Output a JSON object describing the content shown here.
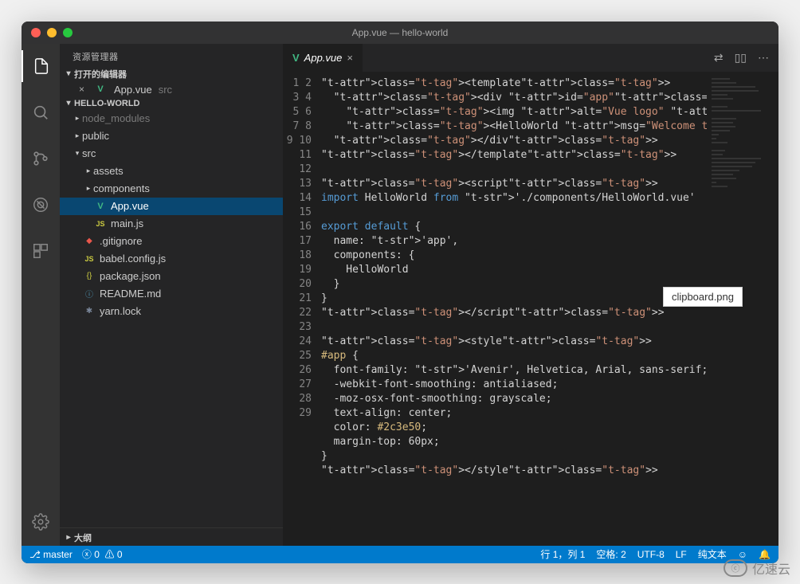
{
  "titlebar": {
    "title": "App.vue — hello-world"
  },
  "sidebar": {
    "title": "资源管理器",
    "open_editors_label": "打开的编辑器",
    "open_editor_file": "App.vue",
    "open_editor_path": "src",
    "project_label": "HELLO-WORLD",
    "outline_label": "大纲",
    "tree": {
      "node_modules": "node_modules",
      "public": "public",
      "src": "src",
      "assets": "assets",
      "components": "components",
      "app_vue": "App.vue",
      "main_js": "main.js",
      "gitignore": ".gitignore",
      "babel": "babel.config.js",
      "package": "package.json",
      "readme": "README.md",
      "yarn": "yarn.lock"
    }
  },
  "tabs": {
    "active": "App.vue"
  },
  "code": {
    "lines": [
      "<template>",
      "  <div id=\"app\">",
      "    <img alt=\"Vue logo\" src=\"./assets/logo.png\">",
      "    <HelloWorld msg=\"Welcome to Your Vue.js App\"/>",
      "  </div>",
      "</template>",
      "",
      "<script>",
      "import HelloWorld from './components/HelloWorld.vue'",
      "",
      "export default {",
      "  name: 'app',",
      "  components: {",
      "    HelloWorld",
      "  }",
      "}",
      "</script>",
      "",
      "<style>",
      "#app {",
      "  font-family: 'Avenir', Helvetica, Arial, sans-serif;",
      "  -webkit-font-smoothing: antialiased;",
      "  -moz-osx-font-smoothing: grayscale;",
      "  text-align: center;",
      "  color: #2c3e50;",
      "  margin-top: 60px;",
      "}",
      "</style>",
      ""
    ],
    "line_count": 29
  },
  "statusbar": {
    "branch": "master",
    "errors": "0",
    "warnings": "0",
    "cursor": "行 1，列 1",
    "spaces": "空格: 2",
    "encoding": "UTF-8",
    "eol": "LF",
    "lang": "纯文本"
  },
  "tooltip": {
    "text": "clipboard.png"
  },
  "watermark": {
    "text": "亿速云"
  }
}
